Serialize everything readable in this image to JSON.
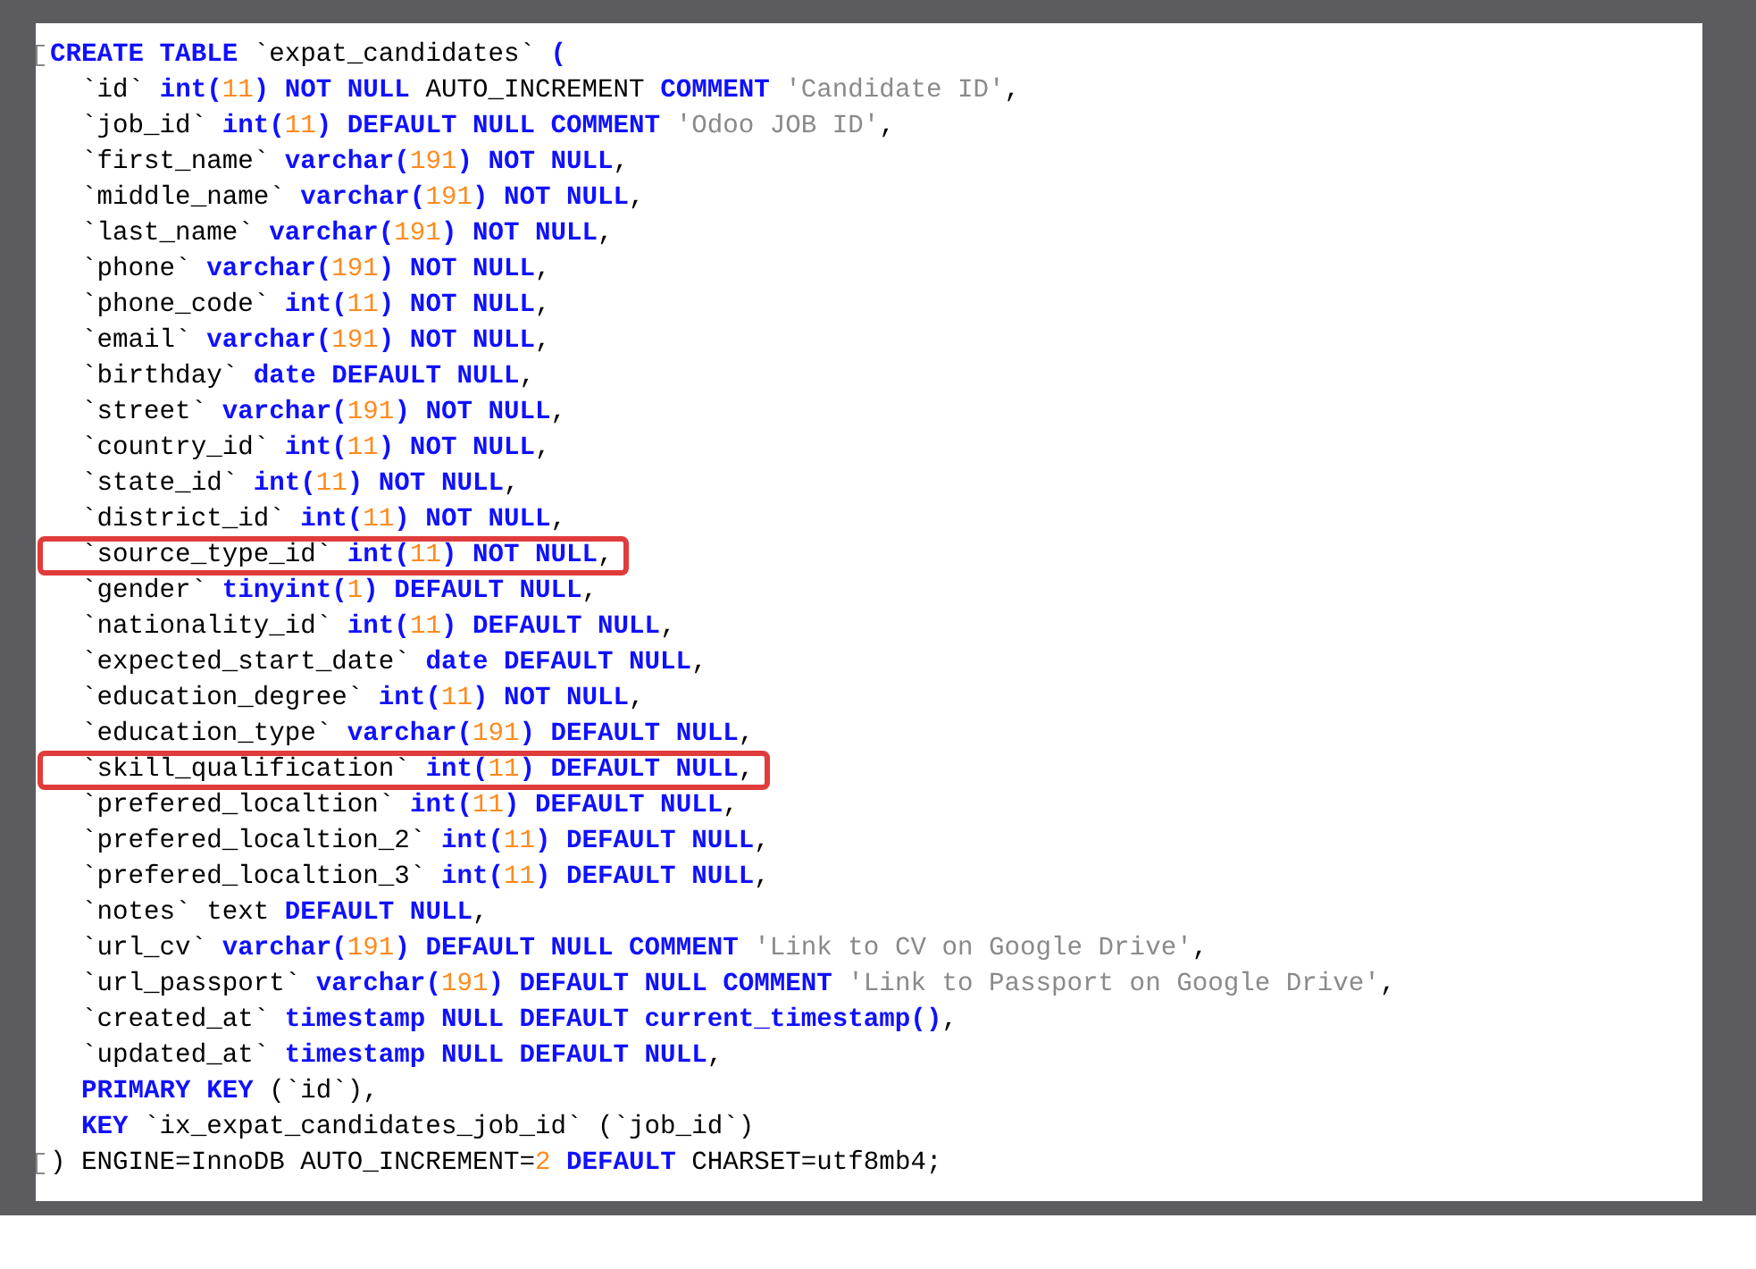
{
  "code_lines": [
    {
      "fold": true,
      "highlighted": false,
      "tokens": [
        {
          "kind": "kw",
          "text": "CREATE TABLE "
        },
        {
          "kind": "plain",
          "text": "`expat_candidates` "
        },
        {
          "kind": "kw",
          "text": "("
        }
      ]
    },
    {
      "fold": false,
      "highlighted": false,
      "tokens": [
        {
          "kind": "plain",
          "text": "  `id` "
        },
        {
          "kind": "kw",
          "text": "int("
        },
        {
          "kind": "num",
          "text": "11"
        },
        {
          "kind": "kw",
          "text": ") NOT NULL "
        },
        {
          "kind": "plain",
          "text": "AUTO_INCREMENT "
        },
        {
          "kind": "kw",
          "text": "COMMENT "
        },
        {
          "kind": "str",
          "text": "'Candidate ID'"
        },
        {
          "kind": "plain",
          "text": ","
        }
      ]
    },
    {
      "fold": false,
      "highlighted": false,
      "tokens": [
        {
          "kind": "plain",
          "text": "  `job_id` "
        },
        {
          "kind": "kw",
          "text": "int("
        },
        {
          "kind": "num",
          "text": "11"
        },
        {
          "kind": "kw",
          "text": ") DEFAULT NULL COMMENT "
        },
        {
          "kind": "str",
          "text": "'Odoo JOB ID'"
        },
        {
          "kind": "plain",
          "text": ","
        }
      ]
    },
    {
      "fold": false,
      "highlighted": false,
      "tokens": [
        {
          "kind": "plain",
          "text": "  `first_name` "
        },
        {
          "kind": "kw",
          "text": "varchar("
        },
        {
          "kind": "num",
          "text": "191"
        },
        {
          "kind": "kw",
          "text": ") NOT NULL"
        },
        {
          "kind": "plain",
          "text": ","
        }
      ]
    },
    {
      "fold": false,
      "highlighted": false,
      "tokens": [
        {
          "kind": "plain",
          "text": "  `middle_name` "
        },
        {
          "kind": "kw",
          "text": "varchar("
        },
        {
          "kind": "num",
          "text": "191"
        },
        {
          "kind": "kw",
          "text": ") NOT NULL"
        },
        {
          "kind": "plain",
          "text": ","
        }
      ]
    },
    {
      "fold": false,
      "highlighted": false,
      "tokens": [
        {
          "kind": "plain",
          "text": "  `last_name` "
        },
        {
          "kind": "kw",
          "text": "varchar("
        },
        {
          "kind": "num",
          "text": "191"
        },
        {
          "kind": "kw",
          "text": ") NOT NULL"
        },
        {
          "kind": "plain",
          "text": ","
        }
      ]
    },
    {
      "fold": false,
      "highlighted": false,
      "tokens": [
        {
          "kind": "plain",
          "text": "  `phone` "
        },
        {
          "kind": "kw",
          "text": "varchar("
        },
        {
          "kind": "num",
          "text": "191"
        },
        {
          "kind": "kw",
          "text": ") NOT NULL"
        },
        {
          "kind": "plain",
          "text": ","
        }
      ]
    },
    {
      "fold": false,
      "highlighted": false,
      "tokens": [
        {
          "kind": "plain",
          "text": "  `phone_code` "
        },
        {
          "kind": "kw",
          "text": "int("
        },
        {
          "kind": "num",
          "text": "11"
        },
        {
          "kind": "kw",
          "text": ") NOT NULL"
        },
        {
          "kind": "plain",
          "text": ","
        }
      ]
    },
    {
      "fold": false,
      "highlighted": false,
      "tokens": [
        {
          "kind": "plain",
          "text": "  `email` "
        },
        {
          "kind": "kw",
          "text": "varchar("
        },
        {
          "kind": "num",
          "text": "191"
        },
        {
          "kind": "kw",
          "text": ") NOT NULL"
        },
        {
          "kind": "plain",
          "text": ","
        }
      ]
    },
    {
      "fold": false,
      "highlighted": false,
      "tokens": [
        {
          "kind": "plain",
          "text": "  `birthday` "
        },
        {
          "kind": "kw",
          "text": "date DEFAULT NULL"
        },
        {
          "kind": "plain",
          "text": ","
        }
      ]
    },
    {
      "fold": false,
      "highlighted": false,
      "tokens": [
        {
          "kind": "plain",
          "text": "  `street` "
        },
        {
          "kind": "kw",
          "text": "varchar("
        },
        {
          "kind": "num",
          "text": "191"
        },
        {
          "kind": "kw",
          "text": ") NOT NULL"
        },
        {
          "kind": "plain",
          "text": ","
        }
      ]
    },
    {
      "fold": false,
      "highlighted": false,
      "tokens": [
        {
          "kind": "plain",
          "text": "  `country_id` "
        },
        {
          "kind": "kw",
          "text": "int("
        },
        {
          "kind": "num",
          "text": "11"
        },
        {
          "kind": "kw",
          "text": ") NOT NULL"
        },
        {
          "kind": "plain",
          "text": ","
        }
      ]
    },
    {
      "fold": false,
      "highlighted": false,
      "tokens": [
        {
          "kind": "plain",
          "text": "  `state_id` "
        },
        {
          "kind": "kw",
          "text": "int("
        },
        {
          "kind": "num",
          "text": "11"
        },
        {
          "kind": "kw",
          "text": ") NOT NULL"
        },
        {
          "kind": "plain",
          "text": ","
        }
      ]
    },
    {
      "fold": false,
      "highlighted": false,
      "tokens": [
        {
          "kind": "plain",
          "text": "  `district_id` "
        },
        {
          "kind": "kw",
          "text": "int("
        },
        {
          "kind": "num",
          "text": "11"
        },
        {
          "kind": "kw",
          "text": ") NOT NULL"
        },
        {
          "kind": "plain",
          "text": ","
        }
      ]
    },
    {
      "fold": false,
      "highlighted": true,
      "tokens": [
        {
          "kind": "plain",
          "text": "  `source_type_id` "
        },
        {
          "kind": "kw",
          "text": "int("
        },
        {
          "kind": "num",
          "text": "11"
        },
        {
          "kind": "kw",
          "text": ") NOT NULL"
        },
        {
          "kind": "plain",
          "text": ","
        }
      ]
    },
    {
      "fold": false,
      "highlighted": false,
      "tokens": [
        {
          "kind": "plain",
          "text": "  `gender` "
        },
        {
          "kind": "kw",
          "text": "tinyint("
        },
        {
          "kind": "num",
          "text": "1"
        },
        {
          "kind": "kw",
          "text": ") DEFAULT NULL"
        },
        {
          "kind": "plain",
          "text": ","
        }
      ]
    },
    {
      "fold": false,
      "highlighted": false,
      "tokens": [
        {
          "kind": "plain",
          "text": "  `nationality_id` "
        },
        {
          "kind": "kw",
          "text": "int("
        },
        {
          "kind": "num",
          "text": "11"
        },
        {
          "kind": "kw",
          "text": ") DEFAULT NULL"
        },
        {
          "kind": "plain",
          "text": ","
        }
      ]
    },
    {
      "fold": false,
      "highlighted": false,
      "tokens": [
        {
          "kind": "plain",
          "text": "  `expected_start_date` "
        },
        {
          "kind": "kw",
          "text": "date DEFAULT NULL"
        },
        {
          "kind": "plain",
          "text": ","
        }
      ]
    },
    {
      "fold": false,
      "highlighted": false,
      "tokens": [
        {
          "kind": "plain",
          "text": "  `education_degree` "
        },
        {
          "kind": "kw",
          "text": "int("
        },
        {
          "kind": "num",
          "text": "11"
        },
        {
          "kind": "kw",
          "text": ") NOT NULL"
        },
        {
          "kind": "plain",
          "text": ","
        }
      ]
    },
    {
      "fold": false,
      "highlighted": false,
      "tokens": [
        {
          "kind": "plain",
          "text": "  `education_type` "
        },
        {
          "kind": "kw",
          "text": "varchar("
        },
        {
          "kind": "num",
          "text": "191"
        },
        {
          "kind": "kw",
          "text": ") DEFAULT NULL"
        },
        {
          "kind": "plain",
          "text": ","
        }
      ]
    },
    {
      "fold": false,
      "highlighted": true,
      "tokens": [
        {
          "kind": "plain",
          "text": "  `skill_qualification` "
        },
        {
          "kind": "kw",
          "text": "int("
        },
        {
          "kind": "num",
          "text": "11"
        },
        {
          "kind": "kw",
          "text": ") DEFAULT NULL"
        },
        {
          "kind": "plain",
          "text": ","
        }
      ]
    },
    {
      "fold": false,
      "highlighted": false,
      "tokens": [
        {
          "kind": "plain",
          "text": "  `prefered_localtion` "
        },
        {
          "kind": "kw",
          "text": "int("
        },
        {
          "kind": "num",
          "text": "11"
        },
        {
          "kind": "kw",
          "text": ") DEFAULT NULL"
        },
        {
          "kind": "plain",
          "text": ","
        }
      ]
    },
    {
      "fold": false,
      "highlighted": false,
      "tokens": [
        {
          "kind": "plain",
          "text": "  `prefered_localtion_2` "
        },
        {
          "kind": "kw",
          "text": "int("
        },
        {
          "kind": "num",
          "text": "11"
        },
        {
          "kind": "kw",
          "text": ") DEFAULT NULL"
        },
        {
          "kind": "plain",
          "text": ","
        }
      ]
    },
    {
      "fold": false,
      "highlighted": false,
      "tokens": [
        {
          "kind": "plain",
          "text": "  `prefered_localtion_3` "
        },
        {
          "kind": "kw",
          "text": "int("
        },
        {
          "kind": "num",
          "text": "11"
        },
        {
          "kind": "kw",
          "text": ") DEFAULT NULL"
        },
        {
          "kind": "plain",
          "text": ","
        }
      ]
    },
    {
      "fold": false,
      "highlighted": false,
      "tokens": [
        {
          "kind": "plain",
          "text": "  `notes` text "
        },
        {
          "kind": "kw",
          "text": "DEFAULT NULL"
        },
        {
          "kind": "plain",
          "text": ","
        }
      ]
    },
    {
      "fold": false,
      "highlighted": false,
      "tokens": [
        {
          "kind": "plain",
          "text": "  `url_cv` "
        },
        {
          "kind": "kw",
          "text": "varchar("
        },
        {
          "kind": "num",
          "text": "191"
        },
        {
          "kind": "kw",
          "text": ") DEFAULT NULL COMMENT "
        },
        {
          "kind": "str",
          "text": "'Link to CV on Google Drive'"
        },
        {
          "kind": "plain",
          "text": ","
        }
      ]
    },
    {
      "fold": false,
      "highlighted": false,
      "tokens": [
        {
          "kind": "plain",
          "text": "  `url_passport` "
        },
        {
          "kind": "kw",
          "text": "varchar("
        },
        {
          "kind": "num",
          "text": "191"
        },
        {
          "kind": "kw",
          "text": ") DEFAULT NULL COMMENT "
        },
        {
          "kind": "str",
          "text": "'Link to Passport on Google Drive'"
        },
        {
          "kind": "plain",
          "text": ","
        }
      ]
    },
    {
      "fold": false,
      "highlighted": false,
      "tokens": [
        {
          "kind": "plain",
          "text": "  `created_at` "
        },
        {
          "kind": "kw",
          "text": "timestamp NULL DEFAULT current_timestamp()"
        },
        {
          "kind": "plain",
          "text": ","
        }
      ]
    },
    {
      "fold": false,
      "highlighted": false,
      "tokens": [
        {
          "kind": "plain",
          "text": "  `updated_at` "
        },
        {
          "kind": "kw",
          "text": "timestamp NULL DEFAULT NULL"
        },
        {
          "kind": "plain",
          "text": ","
        }
      ]
    },
    {
      "fold": false,
      "highlighted": false,
      "tokens": [
        {
          "kind": "kw",
          "text": "  PRIMARY KEY "
        },
        {
          "kind": "plain",
          "text": "(`id`),"
        }
      ]
    },
    {
      "fold": false,
      "highlighted": false,
      "tokens": [
        {
          "kind": "kw",
          "text": "  KEY "
        },
        {
          "kind": "plain",
          "text": "`ix_expat_candidates_job_id` (`job_id`)"
        }
      ]
    },
    {
      "fold": true,
      "highlighted": false,
      "tokens": [
        {
          "kind": "plain",
          "text": ") ENGINE=InnoDB AUTO_INCREMENT="
        },
        {
          "kind": "num",
          "text": "2"
        },
        {
          "kind": "kw",
          "text": " DEFAULT "
        },
        {
          "kind": "plain",
          "text": "CHARSET=utf8mb4;"
        }
      ]
    }
  ]
}
